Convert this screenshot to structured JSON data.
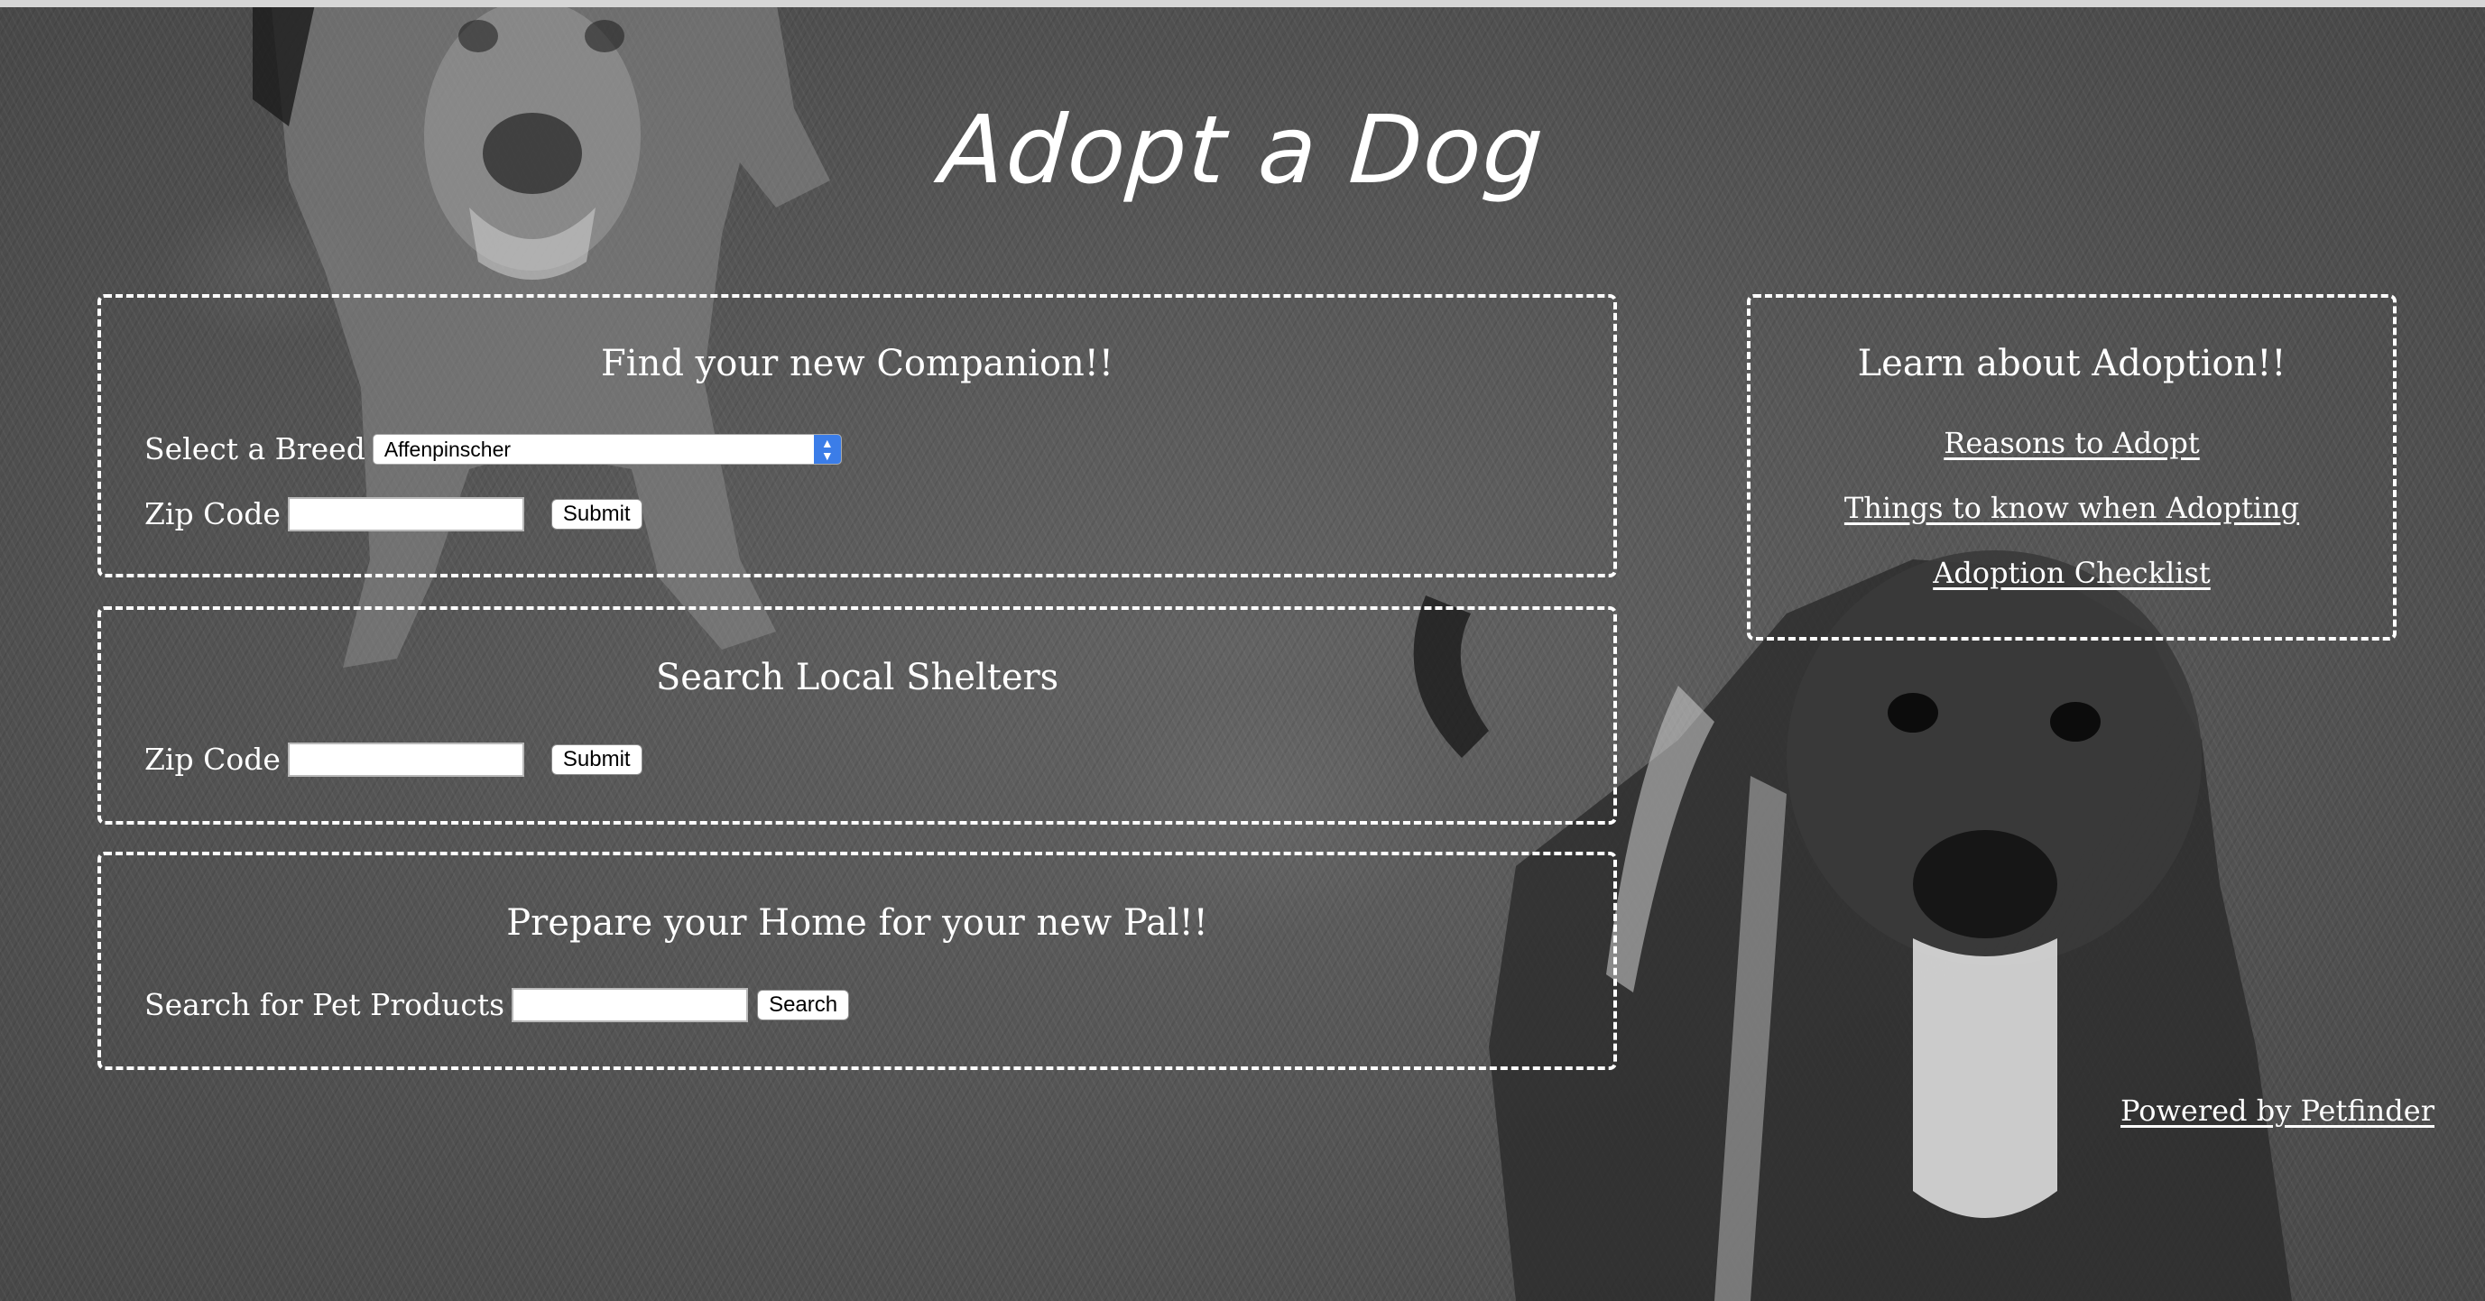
{
  "page": {
    "title": "Adopt a Dog"
  },
  "find_companion": {
    "heading": "Find your new Companion!!",
    "breed_label": "Select a Breed",
    "breed_selected": "Affenpinscher",
    "zip_label": "Zip Code",
    "zip_value": "",
    "submit_label": "Submit"
  },
  "local_shelters": {
    "heading": "Search Local Shelters",
    "zip_label": "Zip Code",
    "zip_value": "",
    "submit_label": "Submit"
  },
  "prepare_home": {
    "heading": "Prepare your Home for your new Pal!!",
    "products_label": "Search for Pet Products",
    "products_value": "",
    "search_label": "Search"
  },
  "learn": {
    "heading": "Learn about Adoption!!",
    "links": [
      "Reasons to Adopt",
      "Things to know when Adopting",
      "Adoption Checklist"
    ]
  },
  "footer": {
    "powered_by": "Powered by Petfinder"
  },
  "icons": {
    "select_arrows": "updown-chevron-icon"
  },
  "colors": {
    "text": "#ffffff",
    "select_accent": "#3b7de8"
  }
}
